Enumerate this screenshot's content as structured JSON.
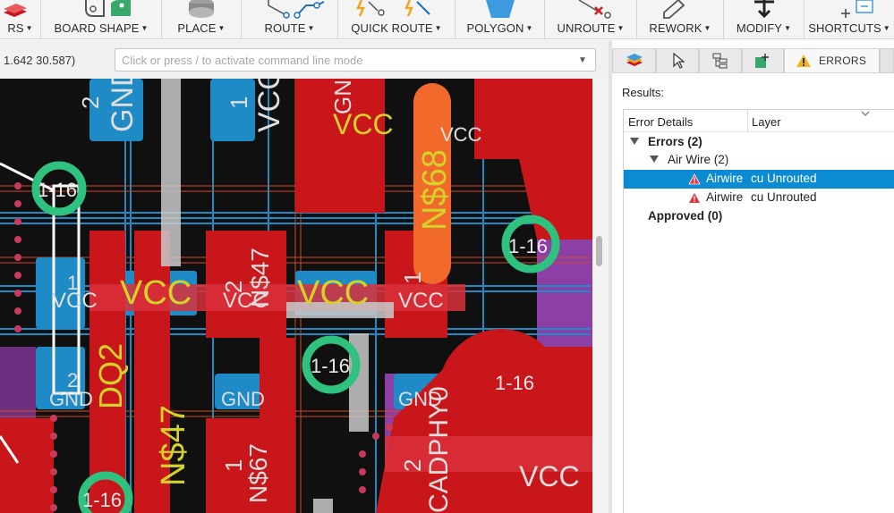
{
  "toolbar": {
    "groups": [
      {
        "id": "layers",
        "label": "RS",
        "icon": "layers-icon"
      },
      {
        "id": "board-shape",
        "label": "BOARD SHAPE",
        "icon": "board-shape-icon"
      },
      {
        "id": "place",
        "label": "PLACE",
        "icon": "place-icon"
      },
      {
        "id": "route",
        "label": "ROUTE",
        "icon": "route-icon"
      },
      {
        "id": "quick-route",
        "label": "QUICK ROUTE",
        "icon": "quick-route-icon"
      },
      {
        "id": "polygon",
        "label": "POLYGON",
        "icon": "polygon-icon"
      },
      {
        "id": "unroute",
        "label": "UNROUTE",
        "icon": "unroute-icon"
      },
      {
        "id": "rework",
        "label": "REWORK",
        "icon": "rework-icon"
      },
      {
        "id": "modify",
        "label": "MODIFY",
        "icon": "modify-icon"
      },
      {
        "id": "shortcuts",
        "label": "SHORTCUTS",
        "icon": "shortcuts-icon"
      }
    ],
    "dropdown_caret": "▼"
  },
  "command": {
    "coords": "1.642 30.587)",
    "placeholder": "Click or press / to activate command line mode"
  },
  "canvas": {
    "labels": {
      "gnd": "GND",
      "vcc": "VCC",
      "n68": "N$68",
      "n47": "N$47",
      "n67": "N$67",
      "dq2": "DQ2",
      "cadphy0": "CADPHY0",
      "via": "1-16",
      "pin1": "1",
      "pin2": "2"
    }
  },
  "panel": {
    "tabs": [
      {
        "id": "layers",
        "icon": "layers-icon"
      },
      {
        "id": "select",
        "icon": "cursor-icon"
      },
      {
        "id": "tree",
        "icon": "tree-icon"
      },
      {
        "id": "add",
        "icon": "add-layer-icon"
      },
      {
        "id": "errors",
        "label": "ERRORS",
        "icon": "warning-icon",
        "active": true
      }
    ],
    "results_label": "Results:",
    "columns": {
      "details": "Error Details",
      "layer": "Layer"
    },
    "tree": {
      "errors_label": "Errors (2)",
      "airwire_group": "Air Wire (2)",
      "rows": [
        {
          "name": "Airwire",
          "layer": "cu Unrouted",
          "selected": true
        },
        {
          "name": "Airwire",
          "layer": "cu Unrouted",
          "selected": false
        }
      ],
      "approved_label": "Approved (0)"
    }
  },
  "colors": {
    "toolbar_bg": "#f4f4f4",
    "pcb_background": "#101010",
    "top_copper": "#c8161b",
    "bottom_copper": "#1e8bc7",
    "silkscreen": "#d4d12a",
    "via_ring": "#2fc27f",
    "selection": "#0b8bd2",
    "warning": "#e2343f"
  }
}
